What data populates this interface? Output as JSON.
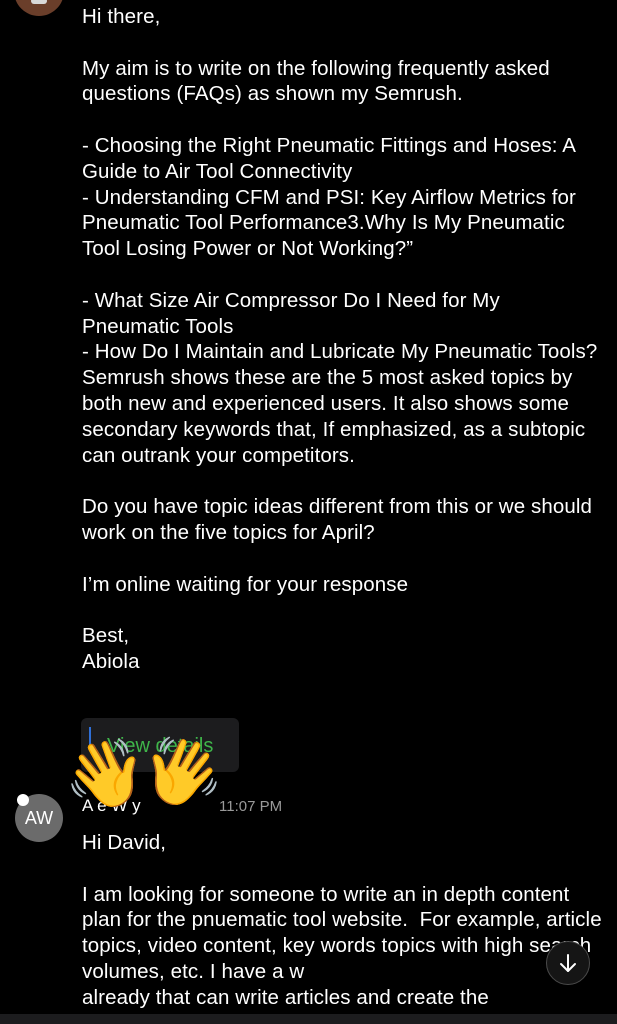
{
  "message1": {
    "lines": [
      "Hi there,",
      "",
      "My aim is to write on the following frequently asked questions (FAQs) as shown my Semrush.",
      "",
      "- Choosing the Right Pneumatic Fittings and Hoses: A Guide to Air Tool Connectivity",
      "- Understanding CFM and PSI: Key Airflow Metrics for Pneumatic Tool Performance3.Why Is My Pneumatic Tool Losing Power or Not Working?”",
      "",
      "- What Size Air Compressor Do I Need for My Pneumatic Tools",
      "- How Do I Maintain and Lubricate My Pneumatic Tools?Semrush shows these are the 5 most asked topics by both new and experienced users. It also shows some secondary keywords that, If emphasized, as a subtopic can outrank your competitors.",
      "",
      "Do you have topic ideas different from this or we should work on the five topics for April?",
      "",
      "I’m online waiting for your response",
      "",
      "Best,",
      "Abiola"
    ],
    "view_details_label": "View details"
  },
  "reaction": {
    "emoji_left": "👋",
    "emoji_right": "👋"
  },
  "message2": {
    "avatar_initials": "AW",
    "sender_name": "A        e W      y",
    "time": "11:07 PM",
    "lines": [
      "Hi David,",
      "",
      "I am looking for someone to write an in depth content plan for the pnuematic tool website.  For example, article topics, video content, key words topics with high search volumes, etc. I have a w",
      "already that can write articles and create the"
    ]
  },
  "colors": {
    "background": "#000000",
    "link_green": "#3fb54a",
    "accent_blue": "#2f6fd6",
    "timestamp_gray": "#9a9a9a"
  },
  "icons": [
    "arrow-down-icon"
  ]
}
